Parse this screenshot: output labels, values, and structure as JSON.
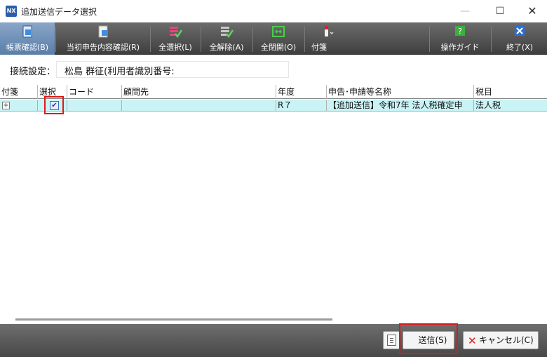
{
  "window": {
    "icon_text": "NX",
    "title": "追加送信データ選択",
    "min_glyph": "—",
    "max_glyph": "☐",
    "close_glyph": "✕"
  },
  "toolbar": {
    "items": [
      {
        "label": "帳票確認(B)",
        "icon": "report-check-icon",
        "active": true
      },
      {
        "label": "当初申告内容確認(R)",
        "icon": "original-return-icon"
      },
      {
        "label": "全選択(L)",
        "icon": "select-all-icon"
      },
      {
        "label": "全解除(A)",
        "icon": "deselect-all-icon"
      },
      {
        "label": "全閉開(O)",
        "icon": "expand-collapse-icon"
      },
      {
        "label": "付箋",
        "icon": "sticky-note-icon"
      },
      {
        "label": "操作ガイド",
        "icon": "help-guide-icon"
      },
      {
        "label": "終了(X)",
        "icon": "exit-icon"
      }
    ]
  },
  "connection": {
    "label": "接続設定：",
    "value": "松島 群征(利用者識別番号:"
  },
  "grid": {
    "columns": [
      "付箋",
      "選択",
      "コード",
      "顧問先",
      "年度",
      "申告･申請等名称",
      "税目"
    ],
    "rows": [
      {
        "expand": "+",
        "selected": "✔",
        "code": "",
        "client": "",
        "year": "R７",
        "name": "【追加送信】令和7年 法人税確定申",
        "tax": "法人税"
      }
    ]
  },
  "buttons": {
    "send": "送信(S)",
    "cancel": "キャンセル(C)",
    "cancel_icon": "✕"
  },
  "colors": {
    "selected_row": "#c9f3f5",
    "highlight": "#e01818",
    "toolbar": "#555555"
  }
}
